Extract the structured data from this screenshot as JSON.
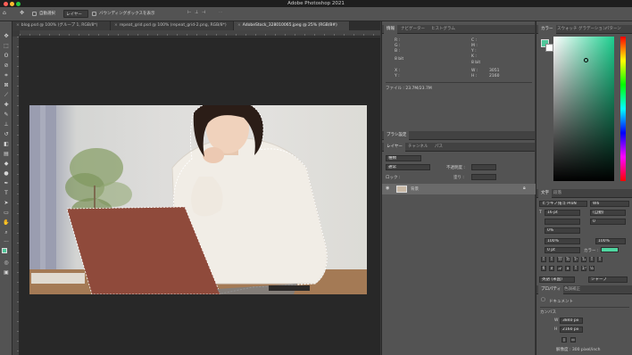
{
  "window": {
    "title": "Adobe Photoshop 2021",
    "traffic": {
      "close": "#ff5f57",
      "minimize": "#febc2e",
      "zoom": "#28c840"
    }
  },
  "options_bar": {
    "auto_select_label": "自動選択",
    "layer_select_value": "レイヤー",
    "bounding_box_label": "バウンディングボックスを表示",
    "extra": "···"
  },
  "tabs": [
    {
      "label": "blog.psd @ 100% (グループ 1, RGB/8*)"
    },
    {
      "label": "repeat_grid.psd @ 100% (repeat_grid-2.png, RGB/8*)"
    },
    {
      "label": "AdobeStock_328010065.jpeg @ 25% (RGB/8#)"
    }
  ],
  "info_panel": {
    "tabs": [
      "情報",
      "ナビゲーター",
      "ヒストグラム"
    ],
    "c_label": "C :",
    "m_label": "M :",
    "y_label": "Y :",
    "k_label": "K :",
    "r_label": "R :",
    "g_label": "G :",
    "b_label": "B :",
    "bit_left": "8 bit",
    "bit_right": "8 bit",
    "x_label": "X :",
    "y2_label": "Y :",
    "w_label": "W :",
    "h_label": "H :",
    "w_value": "3051",
    "h_value": "2160",
    "file_info": "ファイル : 23.7M/23.7M"
  },
  "brush_panel": {
    "title": "ブラシ設定"
  },
  "layers_panel": {
    "tabs": [
      "レイヤー",
      "チャンネル",
      "パス"
    ],
    "kind_label": "種類",
    "blend_mode": "通常",
    "opacity_label": "不透明度 :",
    "lock_label": "ロック :",
    "fill_label": "塗り :",
    "layer_name": "背景",
    "lock_icon": "lock-icon"
  },
  "color_panel": {
    "tabs": [
      "カラー",
      "スウォッチ",
      "グラデーション",
      "パターン"
    ],
    "foreground": "#4fc79a"
  },
  "character_panel": {
    "tabs": [
      "文字",
      "段落"
    ],
    "font_family": "ヒラギノ角ゴ ProN",
    "font_style": "W6",
    "font_size": "16 pt",
    "leading": "(自動)",
    "tracking": "0",
    "kerning_value": "0%",
    "scale_v": "100%",
    "scale_h": "100%",
    "baseline": "0 pt",
    "color_label": "カラー :",
    "lang": "英語 (米国)",
    "aa": "シャープ",
    "text_color": "#4fd6a0"
  },
  "properties_panel": {
    "tabs": [
      "プロパティ",
      "色調補正"
    ],
    "doc_label": "ドキュメント",
    "canvas_label": "カンバス",
    "w_label": "W",
    "h_label": "H",
    "w_value": "3840 px",
    "h_value": "2160 px",
    "resolution": "解像度 : 300 pixel/inch"
  }
}
